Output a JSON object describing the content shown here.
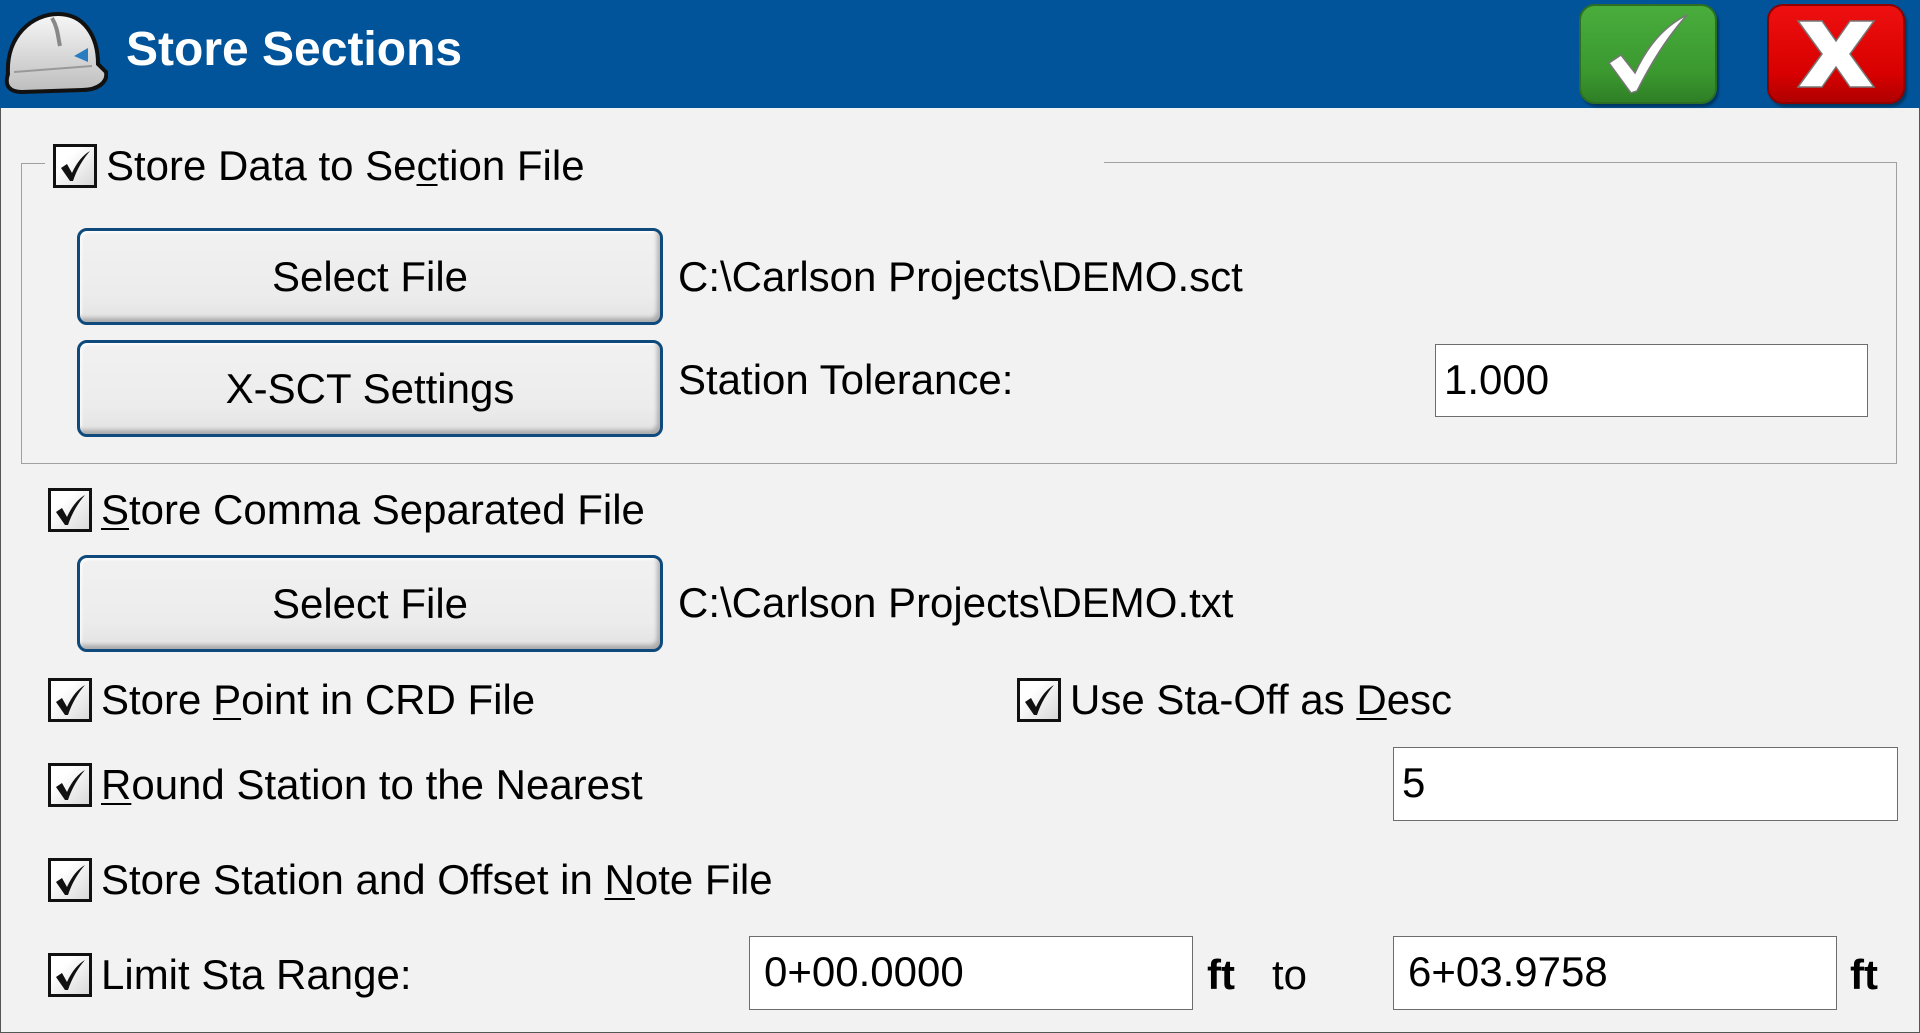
{
  "window": {
    "title": "Store Sections",
    "ok_icon": "checkmark-icon",
    "cancel_icon": "x-icon",
    "colors": {
      "titlebar": "#01549A",
      "ok_button": "#3A982F",
      "cancel_button": "#D80000",
      "button_border": "#0F4A7C",
      "background": "#F2F2F2"
    }
  },
  "section_file": {
    "checkbox": {
      "label_pre": "Store Data to Se",
      "label_mnemonic": "c",
      "label_post": "tion File",
      "checked": true
    },
    "select_file_label": "Select File",
    "file_path": "C:\\Carlson Projects\\DEMO.sct",
    "xsct_settings_label": "X-SCT Settings",
    "station_tolerance_label": "Station Tolerance:",
    "station_tolerance_value": "1.000"
  },
  "comma_file": {
    "checkbox": {
      "label_pre": "",
      "label_mnemonic": "S",
      "label_post": "tore Comma Separated File",
      "checked": true
    },
    "select_file_label": "Select File",
    "file_path": "C:\\Carlson Projects\\DEMO.txt"
  },
  "options": {
    "store_point": {
      "label_pre": "Store ",
      "label_mnemonic": "P",
      "label_post": "oint in CRD File",
      "checked": true
    },
    "use_sta_off": {
      "label_pre": "Use Sta-Off as ",
      "label_mnemonic": "D",
      "label_post": "esc",
      "checked": true
    },
    "round_station": {
      "label_pre": "",
      "label_mnemonic": "R",
      "label_post": "ound Station to the Nearest",
      "checked": true,
      "value": "5"
    },
    "store_note": {
      "label_pre": "Store Station and Offset in ",
      "label_mnemonic": "N",
      "label_post": "ote File",
      "checked": true
    },
    "limit_range": {
      "label": "Limit Sta Range:",
      "checked": true,
      "from_value": "0+00.0000",
      "from_unit": "ft",
      "to_label": "to",
      "to_value": "6+03.9758",
      "to_unit": "ft"
    }
  }
}
